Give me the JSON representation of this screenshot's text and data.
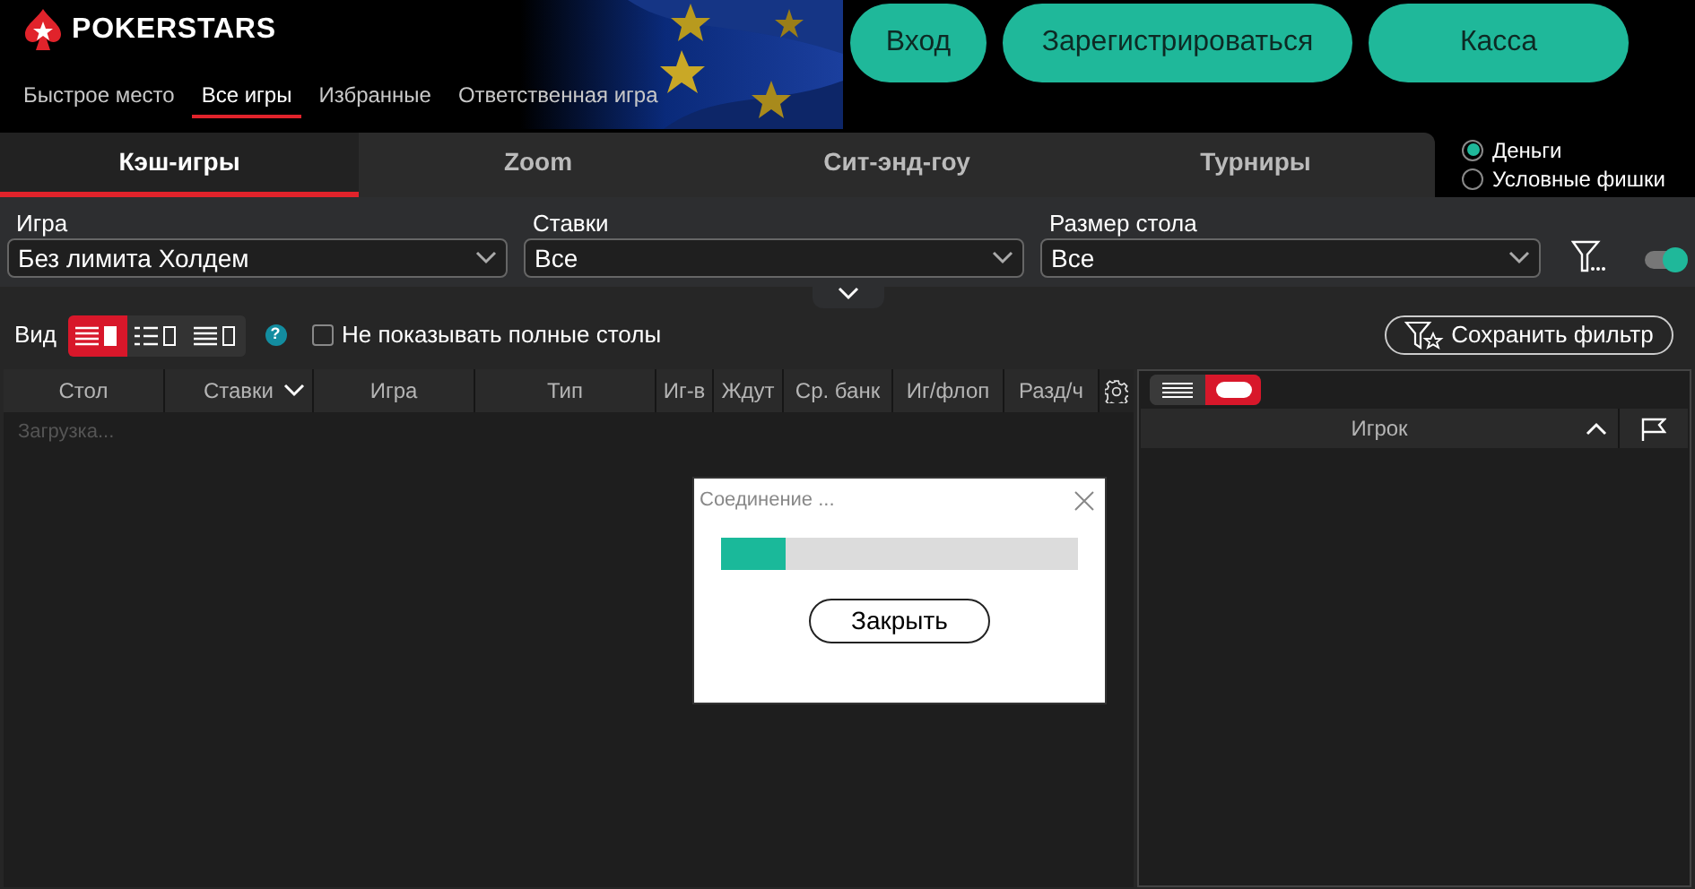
{
  "header": {
    "logo": "POKERSTARS",
    "nav": [
      {
        "label": "Быстрое место",
        "selected": false
      },
      {
        "label": "Все игры",
        "selected": true
      },
      {
        "label": "Избранные",
        "selected": false
      },
      {
        "label": "Ответственная игра",
        "selected": false
      }
    ],
    "buttons": [
      "Вход",
      "Зарегистрироваться",
      "Касса"
    ]
  },
  "tabs": [
    {
      "label": "Кэш-игры",
      "selected": true
    },
    {
      "label": "Zoom",
      "selected": false
    },
    {
      "label": "Сит-энд-гоу",
      "selected": false
    },
    {
      "label": "Турниры",
      "selected": false
    }
  ],
  "currency": [
    {
      "label": "Деньги",
      "selected": true
    },
    {
      "label": "Условные фишки",
      "selected": false
    }
  ],
  "filters": [
    {
      "label": "Игра",
      "value": "Без лимита Холдем"
    },
    {
      "label": "Ставки",
      "value": "Все"
    },
    {
      "label": "Размер стола",
      "value": "Все"
    }
  ],
  "filter_toggle": {
    "on": true
  },
  "view": {
    "label": "Вид",
    "modes": [
      {
        "selected": true
      },
      {
        "selected": false
      },
      {
        "selected": false
      }
    ]
  },
  "help": "?",
  "hide_full": {
    "label": "Не показывать полные столы",
    "checked": false
  },
  "save_filter": "Сохранить фильтр",
  "table": {
    "columns": [
      {
        "label": "Стол",
        "sorted": false
      },
      {
        "label": "Ставки",
        "sorted": true
      },
      {
        "label": "Игра",
        "sorted": false
      },
      {
        "label": "Тип",
        "sorted": false
      },
      {
        "label": "Иг-в",
        "sorted": false
      },
      {
        "label": "Ждут",
        "sorted": false
      },
      {
        "label": "Ср. банк",
        "sorted": false
      },
      {
        "label": "Иг/флоп",
        "sorted": false
      },
      {
        "label": "Разд/ч",
        "sorted": false
      }
    ],
    "status": "Загрузка..."
  },
  "players": {
    "modes": [
      {
        "selected": false
      },
      {
        "selected": true
      }
    ],
    "column": "Игрок"
  },
  "dialog": {
    "title": "Соединение ...",
    "level": 0.18,
    "button": "Закрыть"
  }
}
